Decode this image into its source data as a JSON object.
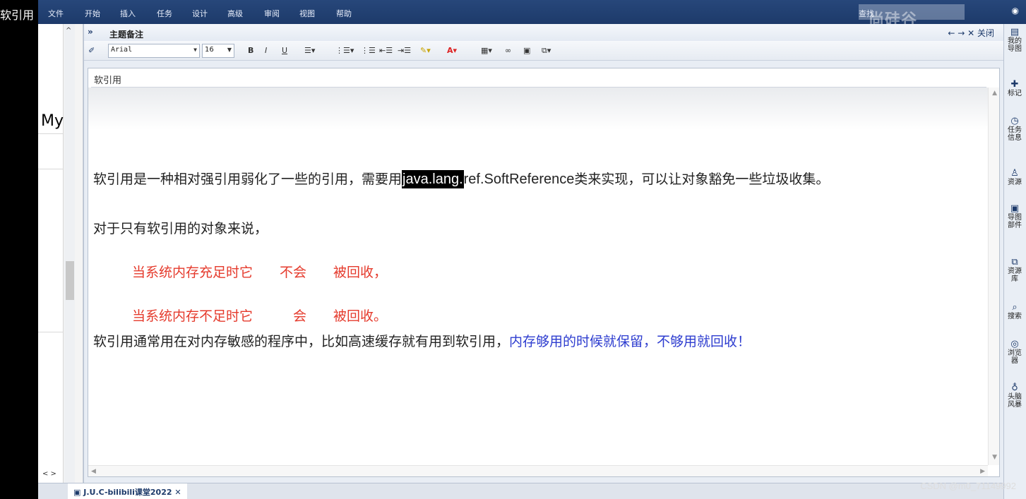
{
  "overlay_title": "软引用",
  "menubar": {
    "items": [
      "文件",
      "开始",
      "插入",
      "任务",
      "设计",
      "高级",
      "审阅",
      "视图",
      "帮助"
    ],
    "search_label": "查找",
    "watermark": "尚硅谷"
  },
  "left_pane": {
    "partial_text": "My"
  },
  "panel": {
    "title": "主题备注",
    "chevrons": "»",
    "close_label": "关闭"
  },
  "toolbar": {
    "font": "Arial",
    "size": "16",
    "bold": "B",
    "italic": "I",
    "underline": "U"
  },
  "editor": {
    "topic_title": "软引用",
    "line1": {
      "before": "软引用是一种相对强引用弱化了一些的引用，需要用",
      "highlight": "java.lang.",
      "code": "ref.SoftReference",
      "after": "类来实现，可以让对象豁免一些垃圾收集。"
    },
    "line2": "对于只有软引用的对象来说，",
    "line3": "当系统内存充足时它　　不会　　被回收，",
    "line4": "当系统内存不足时它　　　会　　被回收。",
    "line5": {
      "before": "软引用通常用在对内存敏感的程序中，比如高速缓存就有用到软引用，",
      "blue": "内存够用的时候就保留，不够用就回收！"
    }
  },
  "right_tabs": [
    "我的导图",
    "标记",
    "任务信息",
    "资源",
    "导图部件",
    "资源库",
    "搜索",
    "浏览器",
    "头脑风暴"
  ],
  "bottom": {
    "doc_tab": "J.U.C-bilibili课堂2022",
    "credit": "CSDN @m0_71149992"
  }
}
